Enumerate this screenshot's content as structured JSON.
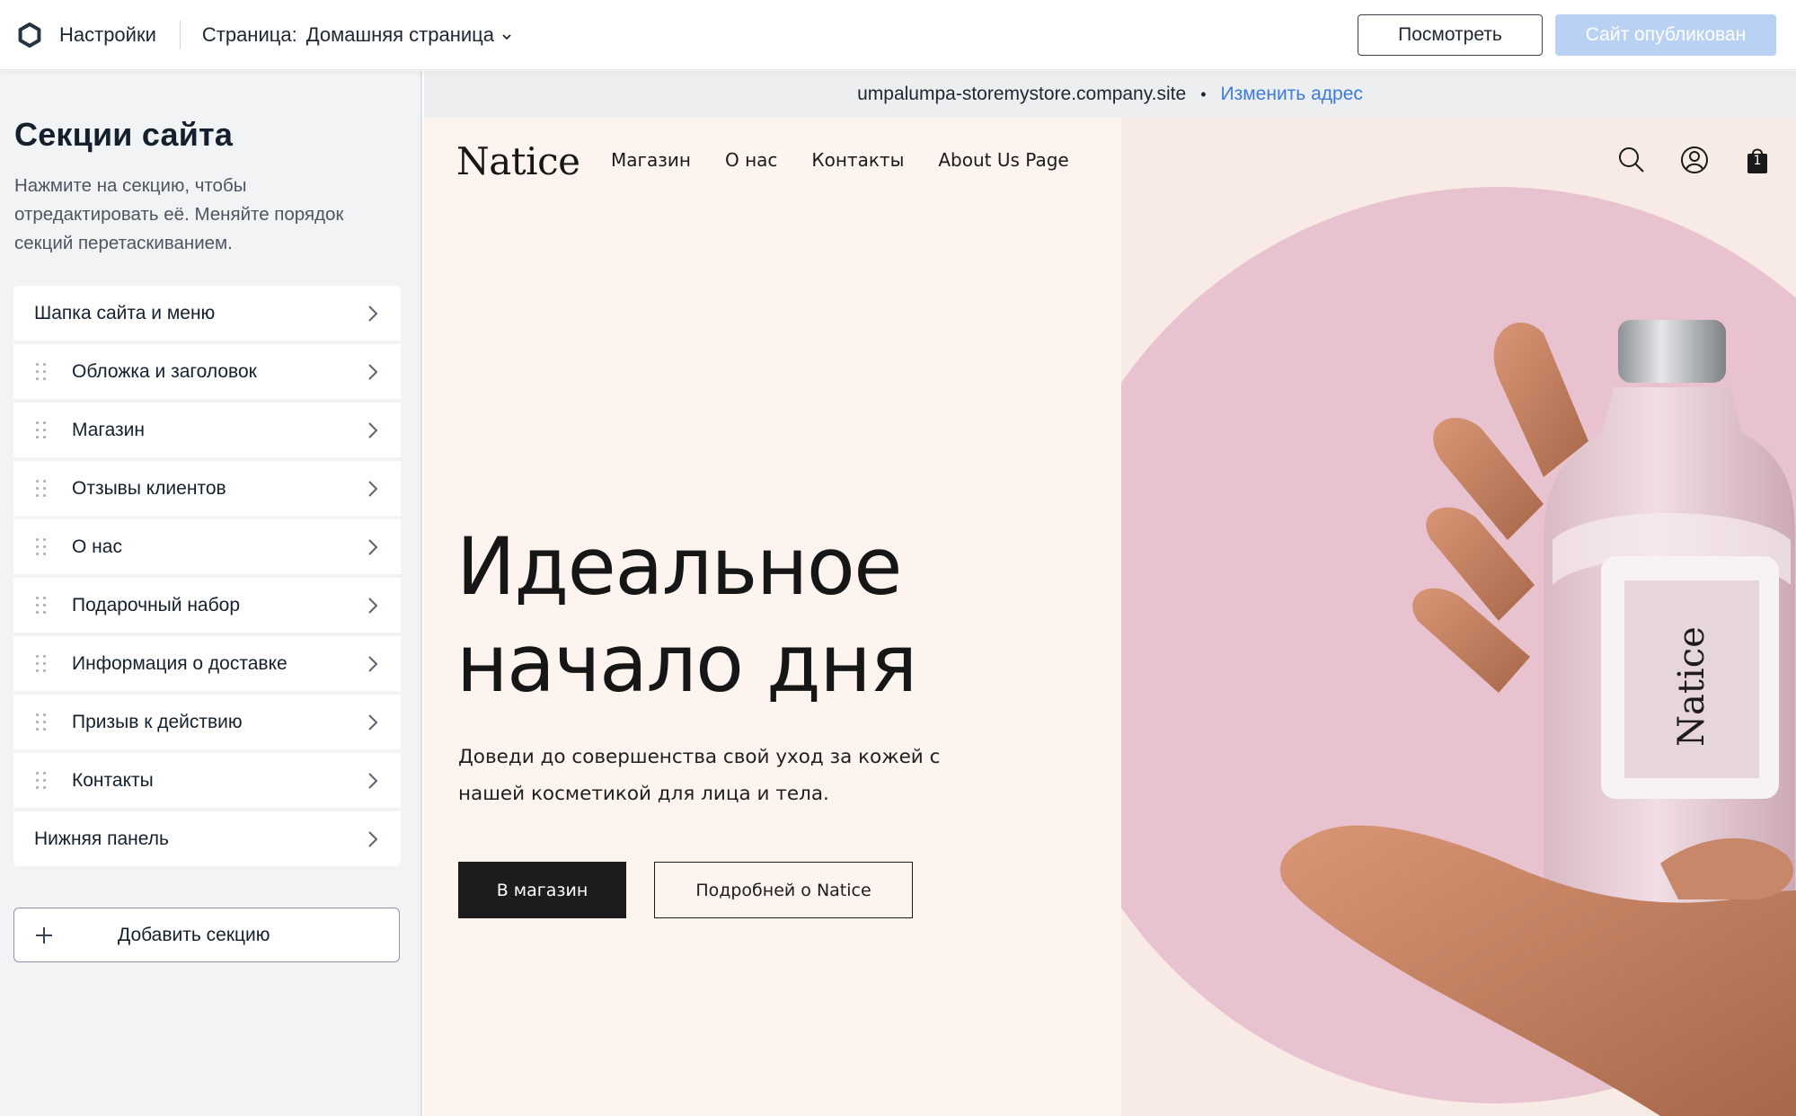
{
  "topbar": {
    "settings_label": "Настройки",
    "page_label": "Страница:",
    "page_value": "Домашняя страница",
    "preview_label": "Посмотреть",
    "published_label": "Сайт опубликован"
  },
  "sidebar": {
    "title": "Секции сайта",
    "description": "Нажмите на секцию, чтобы отредактировать её. Меняйте порядок секций перетаскиванием.",
    "items": [
      {
        "label": "Шапка сайта и меню"
      },
      {
        "label": "Обложка и заголовок"
      },
      {
        "label": "Магазин"
      },
      {
        "label": "Отзывы клиентов"
      },
      {
        "label": "О нас"
      },
      {
        "label": "Подарочный набор"
      },
      {
        "label": "Информация о доставке"
      },
      {
        "label": "Призыв к действию"
      },
      {
        "label": "Контакты"
      },
      {
        "label": "Нижняя панель"
      }
    ],
    "add_section_label": "Добавить секцию"
  },
  "preview": {
    "url": "umpalumpa-storemystore.company.site",
    "url_separator": "•",
    "change_address_label": "Изменить адрес"
  },
  "site": {
    "logo": "Natice",
    "nav": [
      "Магазин",
      "О нас",
      "Контакты",
      "About Us Page"
    ],
    "cart_count": "1",
    "hero_title_line1": "Идеальное",
    "hero_title_line2": "начало дня",
    "hero_subtitle": "Доведи до совершенства свой уход за кожей с нашей косметикой для лица и тела.",
    "shop_button": "В магазин",
    "more_button": "Подробней о Natice",
    "bottle_label": "Natice"
  },
  "colors": {
    "accent_blue": "#3d7be0",
    "published_button": "#b9d2f4",
    "site_background": "#fdf4f0",
    "pink_circle": "#e8c3cf",
    "dark_button": "#1c1c1c"
  },
  "icons": [
    "settings-gear-icon",
    "chevron-down-icon",
    "drag-handle-icon",
    "chevron-right-icon",
    "plus-icon",
    "search-icon",
    "account-icon",
    "cart-bag-icon"
  ]
}
